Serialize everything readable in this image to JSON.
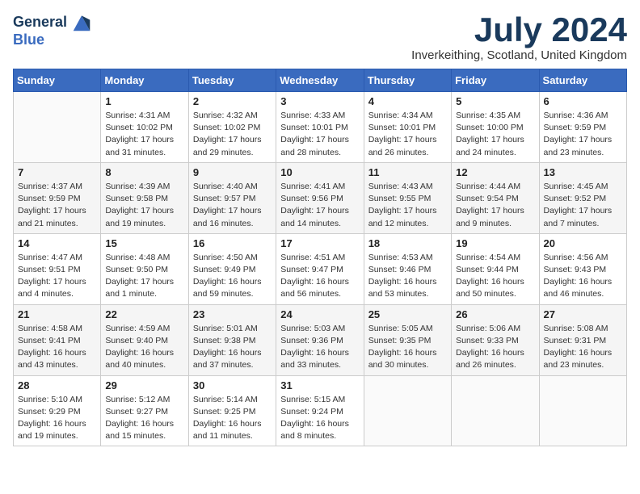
{
  "header": {
    "logo_line1": "General",
    "logo_line2": "Blue",
    "month_title": "July 2024",
    "location": "Inverkeithing, Scotland, United Kingdom"
  },
  "days_of_week": [
    "Sunday",
    "Monday",
    "Tuesday",
    "Wednesday",
    "Thursday",
    "Friday",
    "Saturday"
  ],
  "weeks": [
    [
      {
        "day": "",
        "info": ""
      },
      {
        "day": "1",
        "info": "Sunrise: 4:31 AM\nSunset: 10:02 PM\nDaylight: 17 hours\nand 31 minutes."
      },
      {
        "day": "2",
        "info": "Sunrise: 4:32 AM\nSunset: 10:02 PM\nDaylight: 17 hours\nand 29 minutes."
      },
      {
        "day": "3",
        "info": "Sunrise: 4:33 AM\nSunset: 10:01 PM\nDaylight: 17 hours\nand 28 minutes."
      },
      {
        "day": "4",
        "info": "Sunrise: 4:34 AM\nSunset: 10:01 PM\nDaylight: 17 hours\nand 26 minutes."
      },
      {
        "day": "5",
        "info": "Sunrise: 4:35 AM\nSunset: 10:00 PM\nDaylight: 17 hours\nand 24 minutes."
      },
      {
        "day": "6",
        "info": "Sunrise: 4:36 AM\nSunset: 9:59 PM\nDaylight: 17 hours\nand 23 minutes."
      }
    ],
    [
      {
        "day": "7",
        "info": "Sunrise: 4:37 AM\nSunset: 9:59 PM\nDaylight: 17 hours\nand 21 minutes."
      },
      {
        "day": "8",
        "info": "Sunrise: 4:39 AM\nSunset: 9:58 PM\nDaylight: 17 hours\nand 19 minutes."
      },
      {
        "day": "9",
        "info": "Sunrise: 4:40 AM\nSunset: 9:57 PM\nDaylight: 17 hours\nand 16 minutes."
      },
      {
        "day": "10",
        "info": "Sunrise: 4:41 AM\nSunset: 9:56 PM\nDaylight: 17 hours\nand 14 minutes."
      },
      {
        "day": "11",
        "info": "Sunrise: 4:43 AM\nSunset: 9:55 PM\nDaylight: 17 hours\nand 12 minutes."
      },
      {
        "day": "12",
        "info": "Sunrise: 4:44 AM\nSunset: 9:54 PM\nDaylight: 17 hours\nand 9 minutes."
      },
      {
        "day": "13",
        "info": "Sunrise: 4:45 AM\nSunset: 9:52 PM\nDaylight: 17 hours\nand 7 minutes."
      }
    ],
    [
      {
        "day": "14",
        "info": "Sunrise: 4:47 AM\nSunset: 9:51 PM\nDaylight: 17 hours\nand 4 minutes."
      },
      {
        "day": "15",
        "info": "Sunrise: 4:48 AM\nSunset: 9:50 PM\nDaylight: 17 hours\nand 1 minute."
      },
      {
        "day": "16",
        "info": "Sunrise: 4:50 AM\nSunset: 9:49 PM\nDaylight: 16 hours\nand 59 minutes."
      },
      {
        "day": "17",
        "info": "Sunrise: 4:51 AM\nSunset: 9:47 PM\nDaylight: 16 hours\nand 56 minutes."
      },
      {
        "day": "18",
        "info": "Sunrise: 4:53 AM\nSunset: 9:46 PM\nDaylight: 16 hours\nand 53 minutes."
      },
      {
        "day": "19",
        "info": "Sunrise: 4:54 AM\nSunset: 9:44 PM\nDaylight: 16 hours\nand 50 minutes."
      },
      {
        "day": "20",
        "info": "Sunrise: 4:56 AM\nSunset: 9:43 PM\nDaylight: 16 hours\nand 46 minutes."
      }
    ],
    [
      {
        "day": "21",
        "info": "Sunrise: 4:58 AM\nSunset: 9:41 PM\nDaylight: 16 hours\nand 43 minutes."
      },
      {
        "day": "22",
        "info": "Sunrise: 4:59 AM\nSunset: 9:40 PM\nDaylight: 16 hours\nand 40 minutes."
      },
      {
        "day": "23",
        "info": "Sunrise: 5:01 AM\nSunset: 9:38 PM\nDaylight: 16 hours\nand 37 minutes."
      },
      {
        "day": "24",
        "info": "Sunrise: 5:03 AM\nSunset: 9:36 PM\nDaylight: 16 hours\nand 33 minutes."
      },
      {
        "day": "25",
        "info": "Sunrise: 5:05 AM\nSunset: 9:35 PM\nDaylight: 16 hours\nand 30 minutes."
      },
      {
        "day": "26",
        "info": "Sunrise: 5:06 AM\nSunset: 9:33 PM\nDaylight: 16 hours\nand 26 minutes."
      },
      {
        "day": "27",
        "info": "Sunrise: 5:08 AM\nSunset: 9:31 PM\nDaylight: 16 hours\nand 23 minutes."
      }
    ],
    [
      {
        "day": "28",
        "info": "Sunrise: 5:10 AM\nSunset: 9:29 PM\nDaylight: 16 hours\nand 19 minutes."
      },
      {
        "day": "29",
        "info": "Sunrise: 5:12 AM\nSunset: 9:27 PM\nDaylight: 16 hours\nand 15 minutes."
      },
      {
        "day": "30",
        "info": "Sunrise: 5:14 AM\nSunset: 9:25 PM\nDaylight: 16 hours\nand 11 minutes."
      },
      {
        "day": "31",
        "info": "Sunrise: 5:15 AM\nSunset: 9:24 PM\nDaylight: 16 hours\nand 8 minutes."
      },
      {
        "day": "",
        "info": ""
      },
      {
        "day": "",
        "info": ""
      },
      {
        "day": "",
        "info": ""
      }
    ]
  ]
}
